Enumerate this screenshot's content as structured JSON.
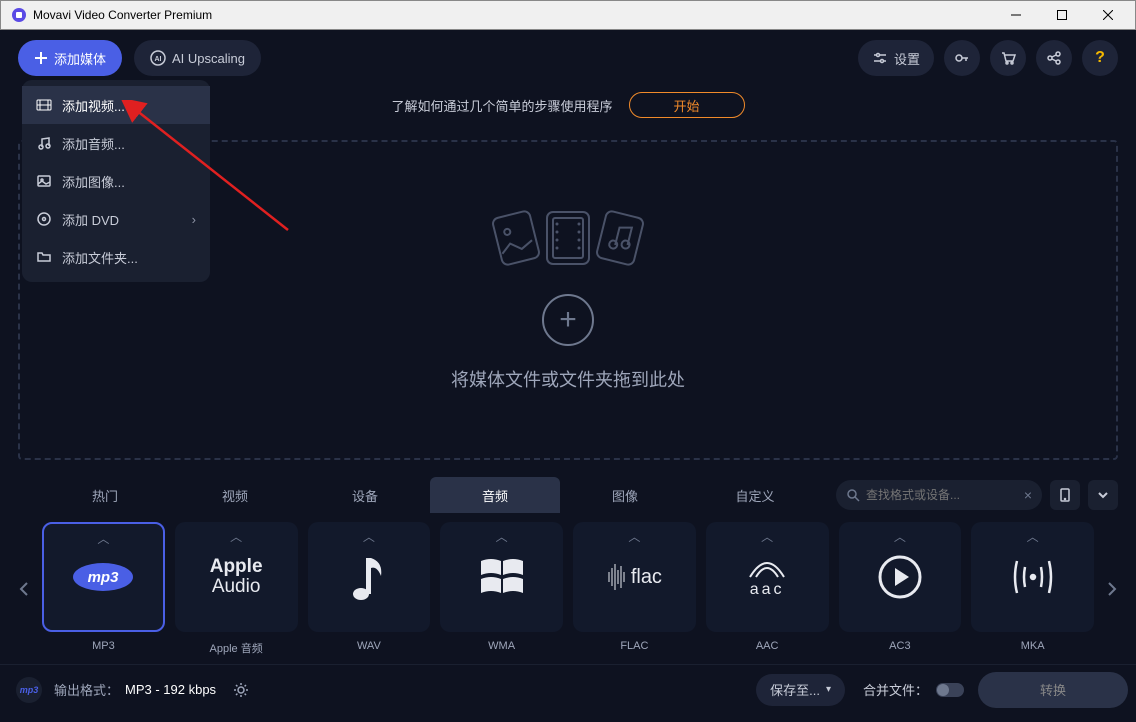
{
  "window": {
    "title": "Movavi Video Converter Premium"
  },
  "toolbar": {
    "add_media": "添加媒体",
    "ai_upscaling": "AI Upscaling",
    "settings": "设置"
  },
  "dropdown": {
    "add_video": "添加视频...",
    "add_audio": "添加音频...",
    "add_image": "添加图像...",
    "add_dvd": "添加 DVD",
    "add_folder": "添加文件夹..."
  },
  "banner": {
    "text": "了解如何通过几个简单的步骤使用程序",
    "start": "开始"
  },
  "dropzone": {
    "text": "将媒体文件或文件夹拖到此处"
  },
  "tabs": {
    "popular": "热门",
    "video": "视频",
    "devices": "设备",
    "audio": "音频",
    "images": "图像",
    "custom": "自定义"
  },
  "search": {
    "placeholder": "查找格式或设备..."
  },
  "formats": [
    {
      "key": "mp3",
      "label": "MP3"
    },
    {
      "key": "apple",
      "label": "Apple 音频"
    },
    {
      "key": "wav",
      "label": "WAV"
    },
    {
      "key": "wma",
      "label": "WMA"
    },
    {
      "key": "flac",
      "label": "FLAC"
    },
    {
      "key": "aac",
      "label": "AAC"
    },
    {
      "key": "ac3",
      "label": "AC3"
    },
    {
      "key": "mka",
      "label": "MKA"
    }
  ],
  "output": {
    "label": "输出格式：",
    "value": "MP3 - 192 kbps",
    "save_to": "保存至...",
    "merge": "合并文件：",
    "convert": "转换"
  },
  "colors": {
    "accent": "#4a5fe5",
    "orange": "#f08a2a"
  }
}
